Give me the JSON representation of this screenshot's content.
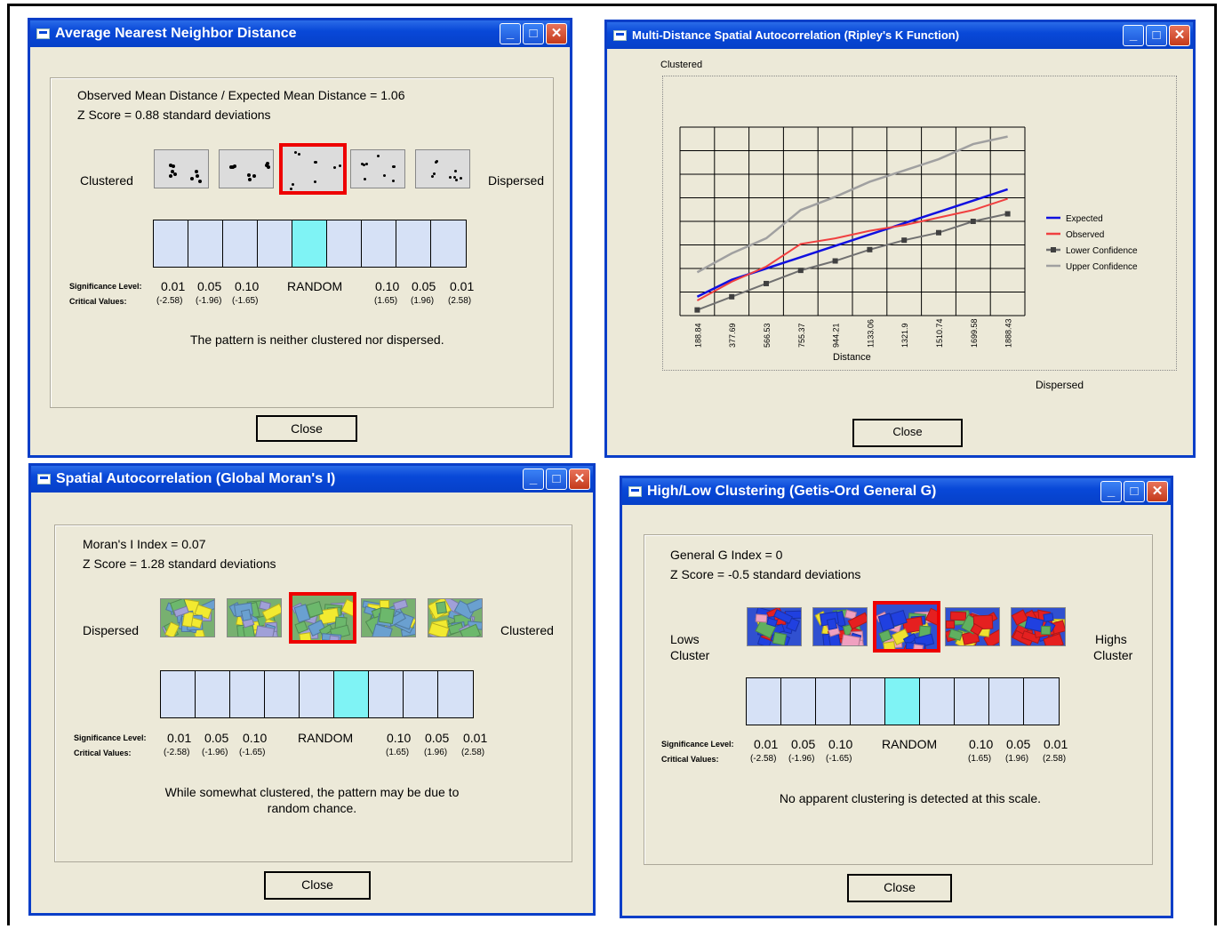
{
  "nn": {
    "title": "Average Nearest Neighbor Distance",
    "line1": "Observed Mean Distance / Expected Mean Distance = 1.06",
    "line2": "Z Score = 0.88 standard deviations",
    "left_label": "Clustered",
    "right_label": "Dispersed",
    "sig_label": "Significance Level:",
    "crit_label": "Critical Values:",
    "levels": [
      "0.01",
      "0.05",
      "0.10",
      "RANDOM",
      "0.10",
      "0.05",
      "0.01"
    ],
    "crit": [
      "(-2.58)",
      "(-1.96)",
      "(-1.65)",
      "(1.65)",
      "(1.96)",
      "(2.58)"
    ],
    "message": "The pattern is neither clustered nor dispersed.",
    "close": "Close"
  },
  "ripley": {
    "title": "Multi-Distance Spatial Autocorrelation (Ripley's K Function)",
    "top_label": "Clustered",
    "bottom_label": "Dispersed",
    "close": "Close"
  },
  "moran": {
    "title": "Spatial Autocorrelation (Global Moran's I)",
    "line1": "Moran's I Index = 0.07",
    "line2": "Z Score = 1.28 standard deviations",
    "left_label": "Dispersed",
    "right_label": "Clustered",
    "sig_label": "Significance Level:",
    "crit_label": "Critical Values:",
    "levels": [
      "0.01",
      "0.05",
      "0.10",
      "RANDOM",
      "0.10",
      "0.05",
      "0.01"
    ],
    "crit": [
      "(-2.58)",
      "(-1.96)",
      "(-1.65)",
      "(1.65)",
      "(1.96)",
      "(2.58)"
    ],
    "message1": "While somewhat clustered, the pattern may be due to",
    "message2": "random chance.",
    "close": "Close"
  },
  "getis": {
    "title": "High/Low Clustering (Getis-Ord General G)",
    "line1": "General G Index = 0",
    "line2": "Z Score = -0.5 standard deviations",
    "left_label_1": "Lows",
    "left_label_2": "Cluster",
    "right_label_1": "Highs",
    "right_label_2": "Cluster",
    "sig_label": "Significance Level:",
    "crit_label": "Critical Values:",
    "levels": [
      "0.01",
      "0.05",
      "0.10",
      "RANDOM",
      "0.10",
      "0.05",
      "0.01"
    ],
    "crit": [
      "(-2.58)",
      "(-1.96)",
      "(-1.65)",
      "(1.65)",
      "(1.96)",
      "(2.58)"
    ],
    "message": "No apparent clustering is detected at this scale.",
    "close": "Close"
  },
  "colors": {
    "title_blue": "#0848d8",
    "highlight": "#7ff3f5",
    "cell": "#d6e1f6",
    "selection": "#ee0000",
    "expected": "#1010e0",
    "observed": "#f04040",
    "lower": "#707070",
    "upper": "#a0a0a0"
  },
  "chart_data": {
    "type": "line",
    "xlabel": "Distance",
    "x": [
      "188.84",
      "377.69",
      "566.53",
      "755.37",
      "944.21",
      "1133.06",
      "1321.9",
      "1510.74",
      "1699.58",
      "1888.43"
    ],
    "series": [
      {
        "name": "Expected",
        "values": [
          1.0,
          1.9,
          2.5,
          3.1,
          3.7,
          4.3,
          4.9,
          5.5,
          6.1,
          6.7
        ]
      },
      {
        "name": "Observed",
        "values": [
          0.8,
          1.8,
          2.6,
          3.8,
          4.1,
          4.5,
          4.8,
          5.2,
          5.6,
          6.2
        ]
      },
      {
        "name": "Lower Confidence",
        "values": [
          0.3,
          1.0,
          1.7,
          2.4,
          2.9,
          3.5,
          4.0,
          4.4,
          5.0,
          5.4
        ]
      },
      {
        "name": "Upper Confidence",
        "values": [
          2.3,
          3.3,
          4.1,
          5.6,
          6.3,
          7.1,
          7.7,
          8.3,
          9.1,
          9.5
        ]
      }
    ],
    "ylim": [
      0,
      10
    ],
    "grid": true,
    "legend": "right"
  }
}
